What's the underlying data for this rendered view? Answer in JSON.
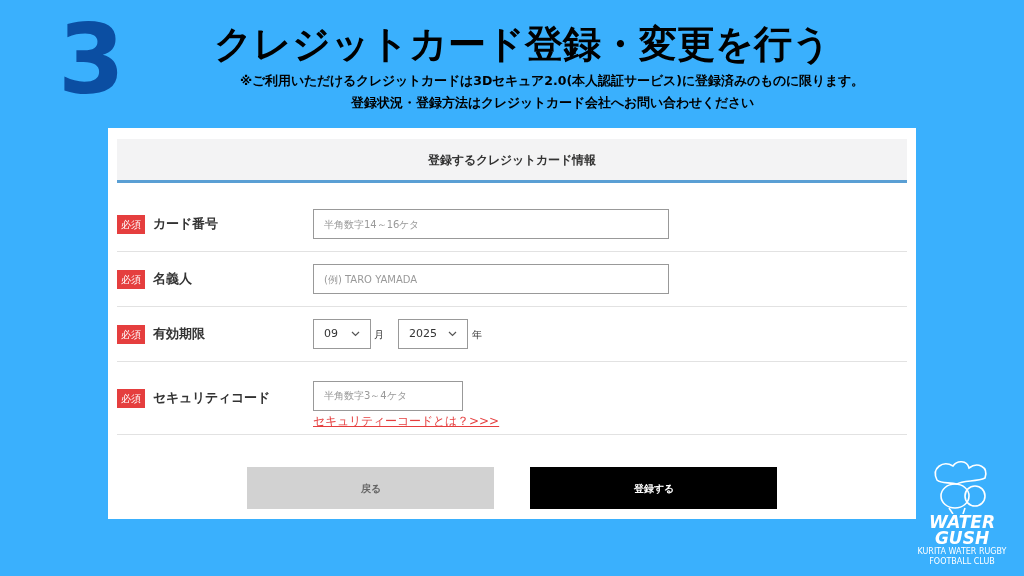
{
  "step": "3",
  "title": "クレジットカード登録・変更を行う",
  "notes": [
    "※ご利用いただけるクレジットカードは3Dセキュア2.0(本人認証サービス)に登録済みのものに限ります。",
    "登録状況・登録方法はクレジットカード会社へお問い合わせください"
  ],
  "form": {
    "heading": "登録するクレジットカード情報",
    "rows": [
      {
        "kind": "text",
        "badge": "必須",
        "label": "カード番号",
        "placeholder": "半角数字14～16ケタ"
      },
      {
        "kind": "text",
        "badge": "必須",
        "label": "名義人",
        "placeholder": "(例) TARO YAMADA"
      },
      {
        "kind": "expiry",
        "badge": "必須",
        "label": "有効期限",
        "month": "09",
        "month_unit": "月",
        "year": "2025",
        "year_unit": "年"
      },
      {
        "kind": "code",
        "badge": "必須",
        "label": "セキュリティコード",
        "placeholder": "半角数字3～4ケタ",
        "link": "セキュリティーコードとは？>>>"
      }
    ],
    "buttons": [
      {
        "label": "戻る",
        "disabled": true
      },
      {
        "label": "登録する",
        "disabled": false
      }
    ]
  },
  "logo": {
    "line_1": "WATER",
    "line_2": "GUSH",
    "tagline": "KURITA WATER RUGBY FOOTBALL CLUB"
  }
}
